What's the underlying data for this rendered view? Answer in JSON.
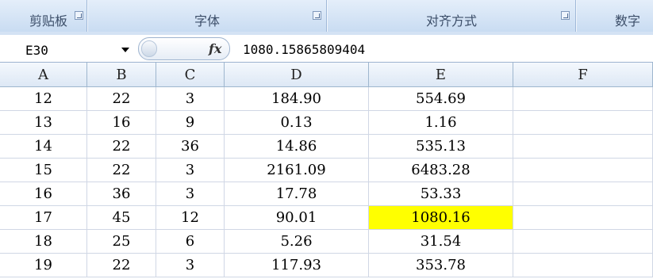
{
  "ribbon": {
    "groups": [
      {
        "label": "剪贴板"
      },
      {
        "label": "字体"
      },
      {
        "label": "对齐方式"
      },
      {
        "label": "数字"
      }
    ]
  },
  "formula_bar": {
    "name_box": "E30",
    "fx_label": "fx",
    "formula": "1080.15865809404"
  },
  "sheet": {
    "columns": [
      "A",
      "B",
      "C",
      "D",
      "E",
      "F"
    ],
    "rows": [
      [
        "12",
        "22",
        "3",
        "184.90",
        "554.69",
        ""
      ],
      [
        "13",
        "16",
        "9",
        "0.13",
        "1.16",
        ""
      ],
      [
        "14",
        "22",
        "36",
        "14.86",
        "535.13",
        ""
      ],
      [
        "15",
        "22",
        "3",
        "2161.09",
        "6483.28",
        ""
      ],
      [
        "16",
        "36",
        "3",
        "17.78",
        "53.33",
        ""
      ],
      [
        "17",
        "45",
        "12",
        "90.01",
        "1080.16",
        ""
      ],
      [
        "18",
        "25",
        "6",
        "5.26",
        "31.54",
        ""
      ],
      [
        "19",
        "22",
        "3",
        "117.93",
        "353.78",
        ""
      ]
    ],
    "highlight_fill": "#ffff00",
    "highlighted_cell": {
      "row": 5,
      "col": 4
    }
  }
}
